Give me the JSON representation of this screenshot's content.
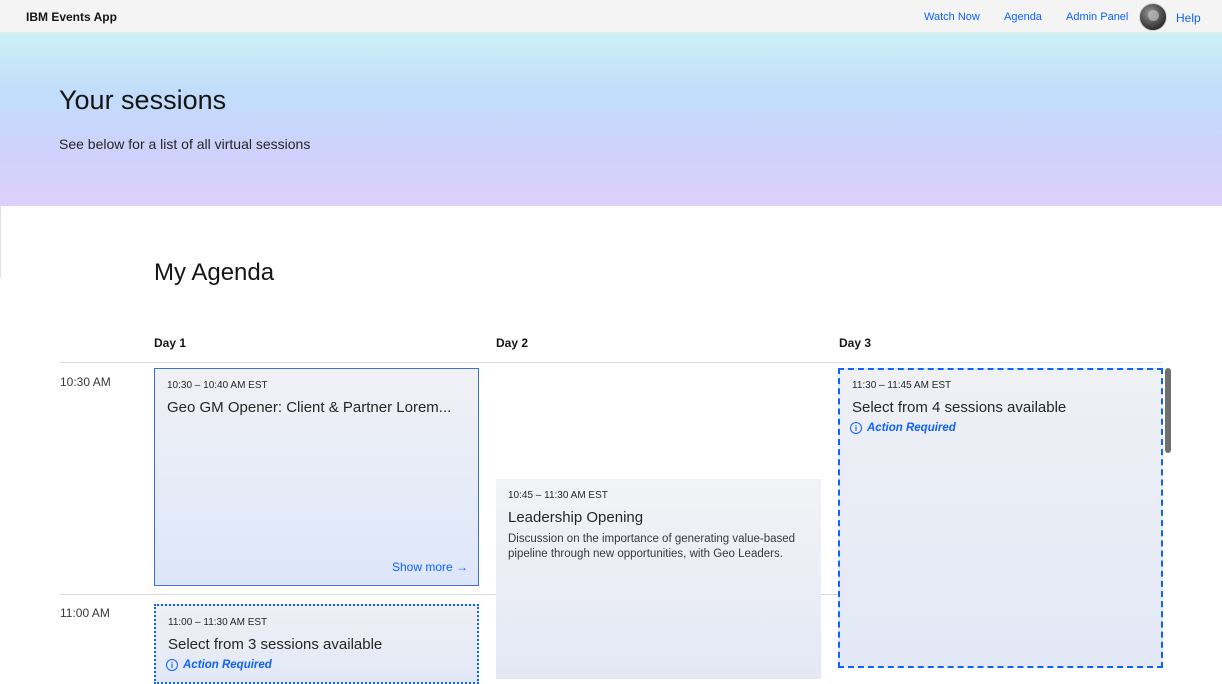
{
  "app": {
    "title": "IBM Events App"
  },
  "nav": {
    "watch_now": "Watch Now",
    "agenda": "Agenda",
    "admin_panel": "Admin Panel",
    "help": "Help",
    "avatar_icon": "user-avatar"
  },
  "hero": {
    "title": "Your sessions",
    "subtitle": "See below for a list of all virtual sessions"
  },
  "agenda": {
    "title": "My Agenda",
    "days": [
      "Day 1",
      "Day 2",
      "Day 3"
    ],
    "times": [
      "10:30 AM",
      "11:00 AM"
    ],
    "sessions": [
      {
        "time": "10:30 – 10:40 AM EST",
        "title": "Geo GM Opener: Client & Partner Lorem...",
        "show_more": "Show more →"
      },
      {
        "time": "11:00 – 11:30 AM EST",
        "title": "Select from 3 sessions available",
        "action": "Action Required"
      },
      {
        "time": "10:45 – 11:30 AM EST",
        "title": "Leadership Opening",
        "description": "Discussion on the importance of generating value-based pipeline through new opportunities, with Geo Leaders."
      },
      {
        "time": "11:30 – 11:45 AM EST",
        "title": "Select from 4 sessions available",
        "action": "Action Required"
      }
    ]
  },
  "colors": {
    "accent": "#0f62fe",
    "text": "#161616"
  }
}
